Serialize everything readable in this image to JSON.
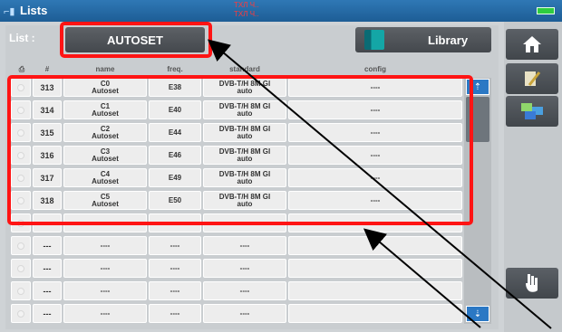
{
  "window": {
    "title": "Lists",
    "status_red_lines": [
      "ТХЛ Ч..",
      "ТХЛ Ч.."
    ]
  },
  "toolbar": {
    "list_label": "List :",
    "autoset_label": "AUTOSET",
    "library_label": "Library"
  },
  "table": {
    "headers": [
      "#",
      "name",
      "freq.",
      "standard",
      "config"
    ],
    "rows": [
      {
        "num": "313",
        "name1": "C0",
        "name2": "Autoset",
        "freq": "E38",
        "std1": "DVB-T/H 8M GI",
        "std2": "auto",
        "config": "----"
      },
      {
        "num": "314",
        "name1": "C1",
        "name2": "Autoset",
        "freq": "E40",
        "std1": "DVB-T/H 8M GI",
        "std2": "auto",
        "config": "----"
      },
      {
        "num": "315",
        "name1": "C2",
        "name2": "Autoset",
        "freq": "E44",
        "std1": "DVB-T/H 8M GI",
        "std2": "auto",
        "config": "----"
      },
      {
        "num": "316",
        "name1": "C3",
        "name2": "Autoset",
        "freq": "E46",
        "std1": "DVB-T/H 8M GI",
        "std2": "auto",
        "config": "----"
      },
      {
        "num": "317",
        "name1": "C4",
        "name2": "Autoset",
        "freq": "E49",
        "std1": "DVB-T/H 8M GI",
        "std2": "auto",
        "config": "----"
      },
      {
        "num": "318",
        "name1": "C5",
        "name2": "Autoset",
        "freq": "E50",
        "std1": "DVB-T/H 8M GI",
        "std2": "auto",
        "config": "----"
      },
      {
        "num": "---",
        "name1": "----",
        "name2": "",
        "freq": "----",
        "std1": "----",
        "std2": "",
        "config": ""
      },
      {
        "num": "---",
        "name1": "----",
        "name2": "",
        "freq": "----",
        "std1": "----",
        "std2": "",
        "config": ""
      },
      {
        "num": "---",
        "name1": "----",
        "name2": "",
        "freq": "----",
        "std1": "----",
        "std2": "",
        "config": ""
      },
      {
        "num": "---",
        "name1": "----",
        "name2": "",
        "freq": "----",
        "std1": "----",
        "std2": "",
        "config": ""
      },
      {
        "num": "---",
        "name1": "----",
        "name2": "",
        "freq": "----",
        "std1": "----",
        "std2": "",
        "config": ""
      }
    ]
  },
  "sidebar": {
    "items": [
      "home-icon",
      "edit-icon",
      "screens-icon",
      "hand-icon"
    ]
  },
  "colors": {
    "titlebar": "#1d5d95",
    "highlight": "#ff1414",
    "scroll_button": "#2b78c4",
    "battery": "#2ecc40"
  }
}
